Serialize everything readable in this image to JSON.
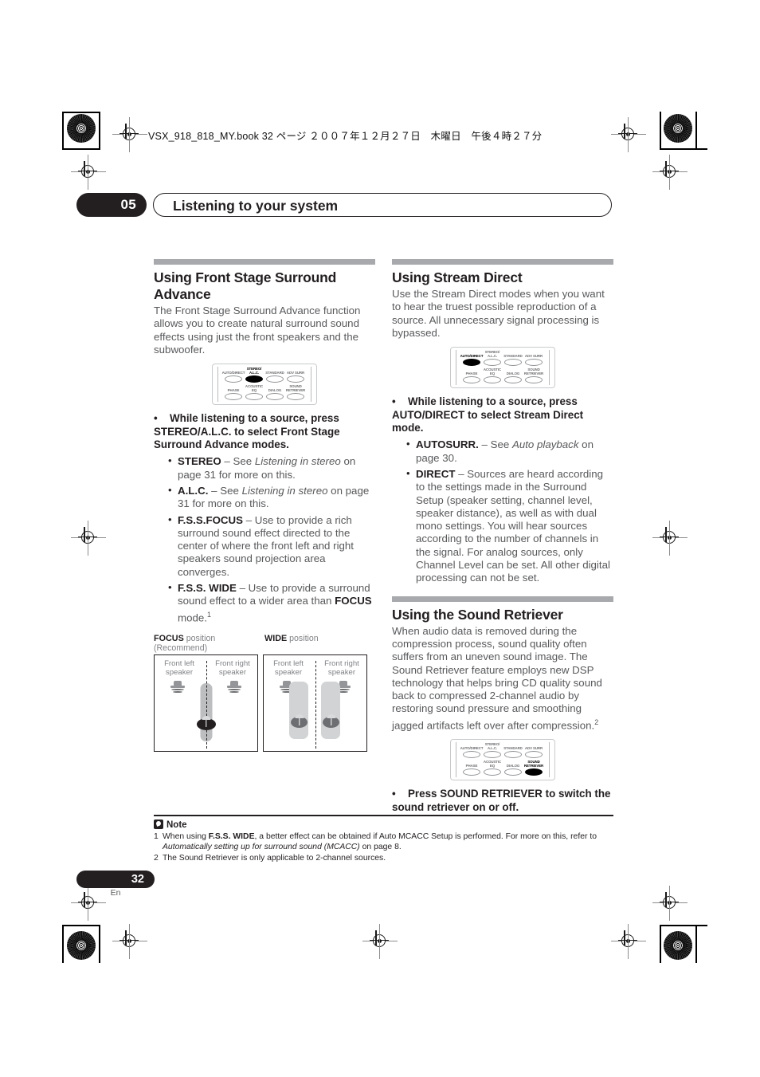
{
  "header": {
    "running_head": "VSX_918_818_MY.book  32 ページ  ２００７年１２月２７日　木曜日　午後４時２７分"
  },
  "chapter": {
    "number": "05",
    "title": "Listening to your system"
  },
  "left_column": {
    "section1": {
      "heading": "Using Front Stage Surround Advance",
      "intro": "The Front Stage Surround Advance function allows you to create natural surround sound effects using just the front speakers and the subwoofer.",
      "remote": {
        "row1": [
          {
            "label": "AUTO/DIRECT",
            "active": false
          },
          {
            "label": "STEREO/ A.L.C.",
            "active": true
          },
          {
            "label": "STANDARD",
            "active": false
          },
          {
            "label": "ADV SURR",
            "active": false
          }
        ],
        "row2": [
          {
            "label": "PHASE",
            "active": false
          },
          {
            "label": "ACOUSTIC EQ",
            "active": false
          },
          {
            "label": "DIALOG",
            "active": false
          },
          {
            "label": "SOUND RETRIEVER",
            "active": false
          }
        ]
      },
      "instruction": "While listening to a source, press STEREO/A.L.C. to select Front Stage Surround Advance modes.",
      "modes": [
        {
          "term": "STEREO",
          "dash": " – See ",
          "italic": "Listening in stereo",
          "rest": " on page 31 for more on this."
        },
        {
          "term": "A.L.C.",
          "dash": " – See ",
          "italic": "Listening in stereo",
          "rest": " on page 31 for more on this."
        },
        {
          "term": "F.S.S.FOCUS",
          "dash": " – Use to provide a rich surround sound effect directed to the center of where the front left and right speakers sound projection area converges.",
          "italic": "",
          "rest": ""
        },
        {
          "term": "F.S.S. WIDE",
          "dash": " – Use to provide a surround sound effect to a wider area than ",
          "italic": "",
          "rest": "",
          "bold_tail": "FOCUS",
          "tail": " mode.",
          "footnote": "1"
        }
      ]
    },
    "figure": {
      "caption_focus_bold": "FOCUS",
      "caption_focus_rest": " position (Recommend)",
      "caption_wide_bold": "WIDE",
      "caption_wide_rest": " position",
      "speaker_left": "Front left speaker",
      "speaker_right": "Front right speaker"
    }
  },
  "right_column": {
    "section2": {
      "heading": "Using Stream Direct",
      "intro": "Use the Stream Direct modes when you want to hear the truest possible reproduction of a source. All unnecessary signal processing is bypassed.",
      "remote": {
        "row1": [
          {
            "label": "AUTO/DIRECT",
            "active": true
          },
          {
            "label": "STEREO/ A.L.C.",
            "active": false
          },
          {
            "label": "STANDARD",
            "active": false
          },
          {
            "label": "ADV SURR",
            "active": false
          }
        ],
        "row2": [
          {
            "label": "PHASE",
            "active": false
          },
          {
            "label": "ACOUSTIC EQ",
            "active": false
          },
          {
            "label": "DIALOG",
            "active": false
          },
          {
            "label": "SOUND RETRIEVER",
            "active": false
          }
        ]
      },
      "instruction": "While listening to a source, press AUTO/DIRECT to select Stream Direct mode.",
      "modes": [
        {
          "term": "AUTOSURR.",
          "dash": " – See ",
          "italic": "Auto playback",
          "rest": " on page 30."
        },
        {
          "term": "DIRECT",
          "dash": " – Sources are heard according to the settings made in the Surround Setup (speaker setting, channel level, speaker distance), as well as with dual mono settings. You will hear sources according to the number of channels in the signal. For analog sources, only Channel Level can be set. All other digital processing can not be set.",
          "italic": "",
          "rest": ""
        }
      ]
    },
    "section3": {
      "heading": "Using the Sound Retriever",
      "intro": "When audio data is removed during the compression process, sound quality often suffers from an uneven sound image. The Sound Retriever feature employs new DSP technology that helps bring CD quality sound back to compressed 2-channel audio by restoring sound pressure and smoothing jagged artifacts left over after compression.",
      "intro_footnote": "2",
      "remote": {
        "row1": [
          {
            "label": "AUTO/DIRECT",
            "active": false
          },
          {
            "label": "STEREO/ A.L.C.",
            "active": false
          },
          {
            "label": "STANDARD",
            "active": false
          },
          {
            "label": "ADV SURR",
            "active": false
          }
        ],
        "row2": [
          {
            "label": "PHASE",
            "active": false
          },
          {
            "label": "ACOUSTIC EQ",
            "active": false
          },
          {
            "label": "DIALOG",
            "active": false
          },
          {
            "label": "SOUND RETRIEVER",
            "active": true
          }
        ]
      },
      "instruction": "Press SOUND RETRIEVER to switch the sound retriever on or off."
    }
  },
  "notes": {
    "title": "Note",
    "items": [
      {
        "num": "1",
        "pre": "When using ",
        "bold": "F.S.S. WIDE",
        "mid": ", a better effect can be obtained if Auto MCACC Setup is performed. For more on this, refer to ",
        "italic": "Automatically setting up for surround sound (MCACC)",
        "post": " on page 8."
      },
      {
        "num": "2",
        "pre": "The Sound Retriever is only applicable to 2-channel sources.",
        "bold": "",
        "mid": "",
        "italic": "",
        "post": ""
      }
    ]
  },
  "folio": {
    "page": "32",
    "language": "En"
  }
}
